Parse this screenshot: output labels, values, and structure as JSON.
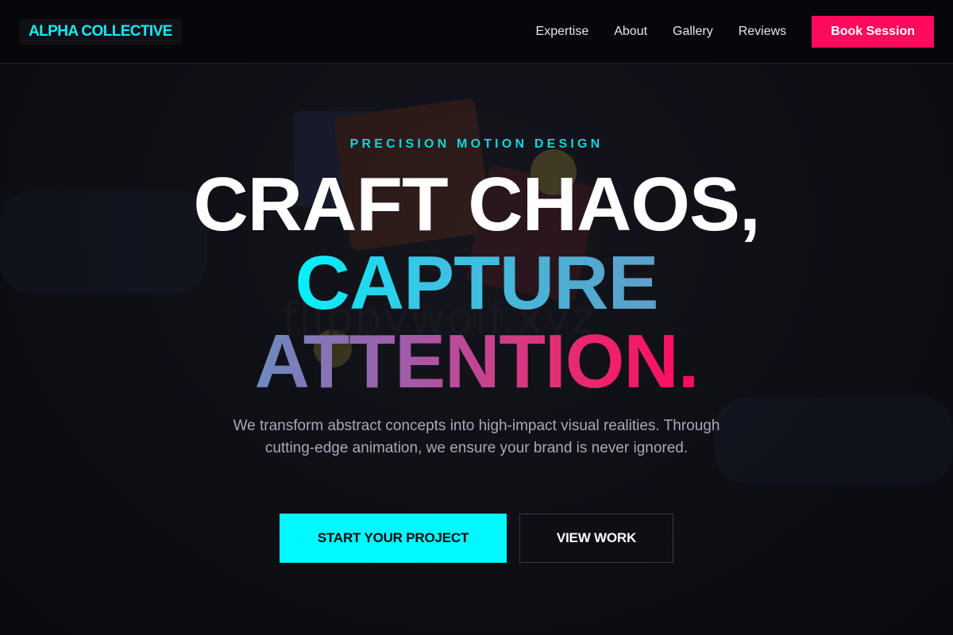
{
  "header": {
    "logo": "ALPHA COLLECTIVE",
    "nav": [
      {
        "label": "Expertise"
      },
      {
        "label": "About"
      },
      {
        "label": "Gallery"
      },
      {
        "label": "Reviews"
      }
    ],
    "cta_label": "Book Session"
  },
  "hero": {
    "eyebrow": "PRECISION MOTION DESIGN",
    "headline_line1": "CRAFT CHAOS,",
    "headline_line2": "CAPTURE",
    "headline_line3_word": "ATTENTION",
    "headline_line3_dot": ".",
    "subtext": "We transform abstract concepts into high-impact visual realities. Through cutting-edge animation, we ensure your brand is never ignored.",
    "primary_button": "START YOUR PROJECT",
    "secondary_button": "VIEW WORK",
    "background_watermark": "flippywolf.xyz"
  },
  "colors": {
    "accent_cyan": "#00f8ff",
    "accent_pink": "#ff0a5c",
    "background": "#0c0c12"
  }
}
